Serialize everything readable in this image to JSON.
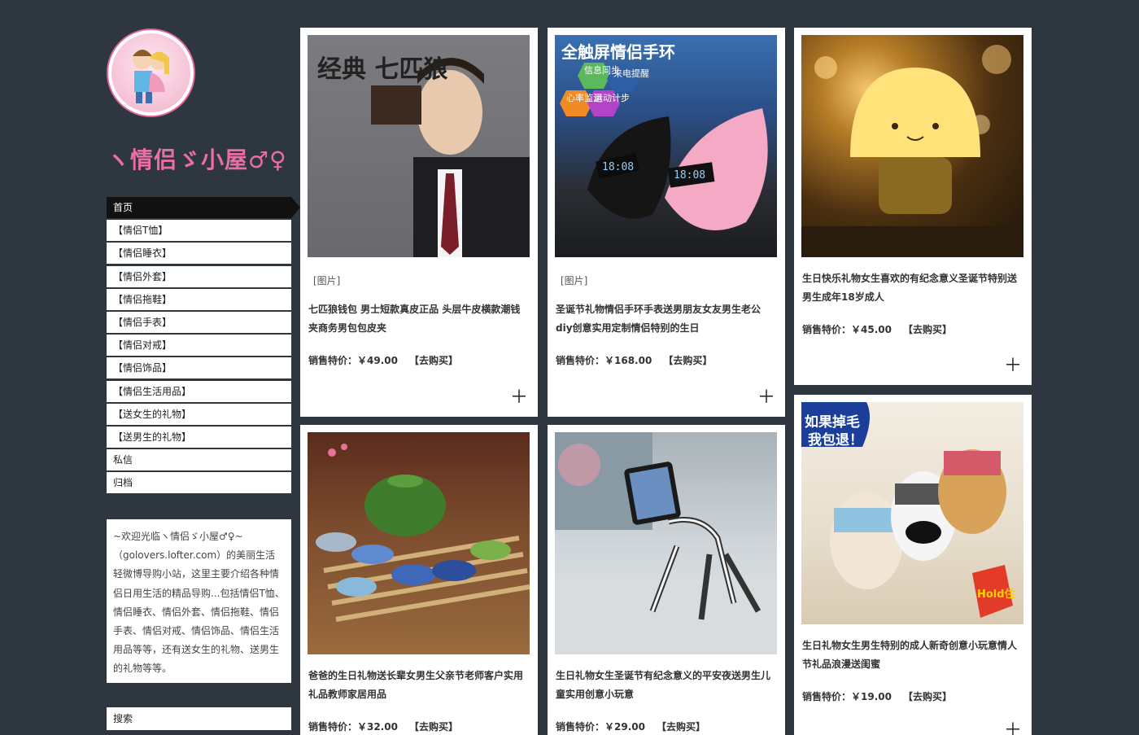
{
  "site": {
    "title": "ヽ情侣ゞ小屋♂♀"
  },
  "nav": {
    "items": [
      {
        "label": "首页",
        "active": true
      },
      {
        "label": "【情侣T恤】"
      },
      {
        "label": "【情侣睡衣】"
      },
      {
        "label": "【情侣外套】"
      },
      {
        "label": "【情侣拖鞋】"
      },
      {
        "label": "【情侣手表】"
      },
      {
        "label": "【情侣对戒】"
      },
      {
        "label": "【情侣饰品】"
      },
      {
        "label": "【情侣生活用品】"
      },
      {
        "label": "【送女生的礼物】"
      },
      {
        "label": "【送男生的礼物】"
      },
      {
        "label": "私信"
      },
      {
        "label": "归档"
      }
    ]
  },
  "intro": {
    "text": "~欢迎光临ヽ情侣ゞ小屋♂♀~（golovers.lofter.com）的美丽生活轻微博导购小站，这里主要介绍各种情侣日用生活的精品导购...包括情侣T恤、情侣睡衣、情侣外套、情侣拖鞋、情侣手表、情侣对戒、情侣饰品、情侣生活用品等等，还有送女生的礼物、送男生的礼物等等。"
  },
  "search": {
    "label": "搜索"
  },
  "products": [
    {
      "tag": "[图片]",
      "desc": "七匹狼钱包 男士短款真皮正品 头层牛皮横款潮钱夹商务男包包皮夹",
      "price": "销售特价：￥49.00",
      "buy": "【去购买】",
      "image_icon": "wallet-man-photo",
      "image_text": "经典  七匹狼"
    },
    {
      "tag": "[图片]",
      "desc": "圣诞节礼物情侣手环手表送男朋友女友男生老公diy创意实用定制情侣特别的生日",
      "price": "销售特价：￥168.00",
      "buy": "【去购买】",
      "image_icon": "smart-band-photo",
      "image_text": "全触屏情侣手环",
      "image_badges": [
        "信息同步",
        "来电提醒",
        "心率监测",
        "运动计步"
      ]
    },
    {
      "tag": "",
      "desc": "生日快乐礼物女生喜欢的有纪念意义圣诞节特别送男生成年18岁成人",
      "price": "销售特价：￥45.00",
      "buy": "【去购买】",
      "image_icon": "mushroom-lamp-photo"
    },
    {
      "tag": "",
      "desc": "爸爸的生日礼物送长辈女男生父亲节老师客户实用礼品教师家居用品",
      "price": "销售特价：￥32.00",
      "buy": "【去购买】",
      "image_icon": "tea-set-photo"
    },
    {
      "tag": "",
      "desc": "生日礼物女生圣诞节有纪念意义的平安夜送男生儿童实用创意小玩意",
      "price": "销售特价：￥29.00",
      "buy": "【去购买】",
      "image_icon": "zebra-phone-stand-photo"
    },
    {
      "tag": "",
      "desc": "生日礼物女生男生特别的成人新奇创意小玩意情人节礼品浪漫送闺蜜",
      "price": "销售特价：￥19.00",
      "buy": "【去购买】",
      "image_icon": "plush-dogs-photo",
      "image_text": "如果掉毛 我包退！"
    }
  ],
  "colors": {
    "background": "#2e3640",
    "title_pink": "#e86fa1",
    "card": "#ffffff",
    "nav_active": "#111111"
  }
}
